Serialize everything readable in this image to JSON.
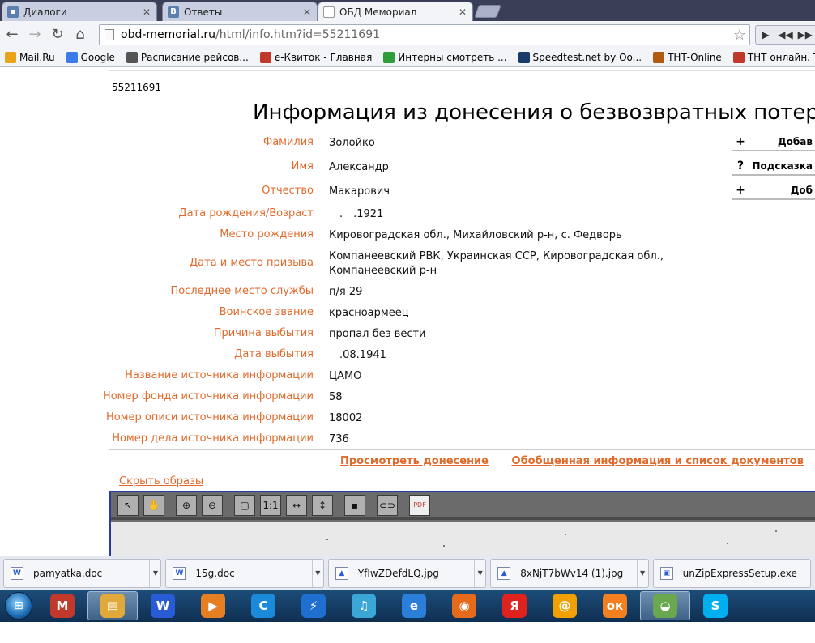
{
  "browser": {
    "tabs": [
      {
        "label": "Диалоги",
        "icon": "vk-messages-icon",
        "active": false
      },
      {
        "label": "Ответы",
        "icon": "vk-icon",
        "active": false
      },
      {
        "label": "ОБД Мемориал",
        "icon": "page-icon",
        "active": true
      }
    ],
    "url_host": "obd-memorial.ru",
    "url_rest": "/html/info.htm?id=55211691",
    "bookmarks": [
      {
        "label": "Mail.Ru",
        "icon": "mailru-icon",
        "color": "#e8a317"
      },
      {
        "label": "Google",
        "icon": "google-icon",
        "color": "#3b7be9"
      },
      {
        "label": "Расписание рейсов...",
        "icon": "flight-schedule-icon",
        "color": "#555555"
      },
      {
        "label": "e-Квиток - Главная",
        "icon": "ticket-icon",
        "color": "#c0392b"
      },
      {
        "label": "Интерны смотреть ...",
        "icon": "play-icon",
        "color": "#2e9e3a"
      },
      {
        "label": "Speedtest.net by Oo...",
        "icon": "speedtest-icon",
        "color": "#1a3a6b"
      },
      {
        "label": "ТНТ-Online",
        "icon": "tnt-icon",
        "color": "#b35a12"
      },
      {
        "label": "ТНТ онлайн. Телек...",
        "icon": "tv-icon",
        "color": "#c0392b"
      }
    ]
  },
  "record": {
    "id": "55211691",
    "title": "Информация из донесения о безвозвратных потер",
    "fields": [
      {
        "label": "Фамилия",
        "value": "Золойко"
      },
      {
        "label": "Имя",
        "value": "Александр"
      },
      {
        "label": "Отчество",
        "value": "Макарович"
      },
      {
        "label": "Дата рождения/Возраст",
        "value": "__.__.1921"
      },
      {
        "label": "Место рождения",
        "value": "Кировоградская обл., Михайловский р-н, с. Федворь"
      },
      {
        "label": "Дата и место призыва",
        "value": "Компанеевский РВК, Украинская ССР, Кировоградская обл., Компанеевский р-н"
      },
      {
        "label": "Последнее место службы",
        "value": "п/я 29"
      },
      {
        "label": "Воинское звание",
        "value": "красноармеец"
      },
      {
        "label": "Причина выбытия",
        "value": "пропал без вести"
      },
      {
        "label": "Дата выбытия",
        "value": "__.08.1941"
      },
      {
        "label": "Название источника информации",
        "value": "ЦАМО"
      },
      {
        "label": "Номер фонда источника информации",
        "value": "58"
      },
      {
        "label": "Номер описи источника информации",
        "value": "18002"
      },
      {
        "label": "Номер дела источника информации",
        "value": "736"
      }
    ],
    "side_buttons": [
      {
        "symbol": "+",
        "label": "Добав"
      },
      {
        "symbol": "?",
        "label": "Подсказка"
      },
      {
        "symbol": "+",
        "label": "Доб"
      }
    ],
    "view_report_link": "Просмотреть донесение",
    "summary_link": "Обобщенная информация и список документов",
    "hide_images_link": "Скрыть образы"
  },
  "viewer_tools": [
    {
      "name": "pointer-tool-icon",
      "glyph": "↖"
    },
    {
      "name": "hand-tool-icon",
      "glyph": "✋"
    },
    {
      "name": "zoom-in-icon",
      "glyph": "⊕"
    },
    {
      "name": "zoom-out-icon",
      "glyph": "⊖"
    },
    {
      "name": "fit-page-icon",
      "glyph": "▢"
    },
    {
      "name": "actual-size-icon",
      "glyph": "1:1"
    },
    {
      "name": "fit-width-icon",
      "glyph": "↔"
    },
    {
      "name": "fit-height-icon",
      "glyph": "↕"
    },
    {
      "name": "save-icon",
      "glyph": "▪"
    },
    {
      "name": "link-icon",
      "glyph": "⊂⊃"
    },
    {
      "name": "pdf-icon",
      "glyph": "PDF"
    }
  ],
  "downloads": [
    {
      "name": "pamyatka.doc",
      "icon": "doc-file-icon"
    },
    {
      "name": "15g.doc",
      "icon": "doc-file-icon"
    },
    {
      "name": "YfIwZDefdLQ.jpg",
      "icon": "image-file-icon"
    },
    {
      "name": "8xNjT7bWv14 (1).jpg",
      "icon": "image-file-icon"
    },
    {
      "name": "unZipExpressSetup.exe",
      "icon": "exe-file-icon"
    }
  ],
  "taskbar": [
    {
      "name": "mcafee-icon",
      "glyph": "M",
      "color": "#c0392b",
      "active": false
    },
    {
      "name": "file-explorer-icon",
      "glyph": "▤",
      "color": "#e0a93a",
      "active": true
    },
    {
      "name": "word-icon",
      "glyph": "W",
      "color": "#2a5bd7",
      "active": false
    },
    {
      "name": "media-player-icon",
      "glyph": "▶",
      "color": "#e67e22",
      "active": false
    },
    {
      "name": "ccleaner-icon",
      "glyph": "C",
      "color": "#1c8adb",
      "active": false
    },
    {
      "name": "thunder-icon",
      "glyph": "⚡",
      "color": "#1f6fd1",
      "active": false
    },
    {
      "name": "music-player-icon",
      "glyph": "♫",
      "color": "#3aa7d6",
      "active": false
    },
    {
      "name": "internet-explorer-icon",
      "glyph": "e",
      "color": "#2b7fd8",
      "active": false
    },
    {
      "name": "firefox-icon",
      "glyph": "◉",
      "color": "#e56a1b",
      "active": false
    },
    {
      "name": "yandex-browser-icon",
      "glyph": "Я",
      "color": "#e0221f",
      "active": false
    },
    {
      "name": "mail-agent-icon",
      "glyph": "@",
      "color": "#f0a000",
      "active": false
    },
    {
      "name": "odnoklassniki-icon",
      "glyph": "ок",
      "color": "#f2801f",
      "active": false
    },
    {
      "name": "chrome-icon",
      "glyph": "◒",
      "color": "#6aa84f",
      "active": true
    },
    {
      "name": "skype-icon",
      "glyph": "S",
      "color": "#00aff0",
      "active": false
    }
  ],
  "colors": {
    "label_orange": "#e06a2b",
    "viewer_border": "#2a3aa8"
  }
}
